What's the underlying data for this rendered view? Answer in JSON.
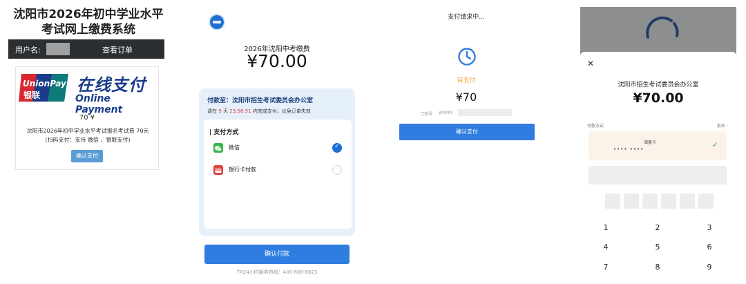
{
  "panel1": {
    "title": "沈阳市2026年初中学业水平考试网上缴费系统",
    "user_label": "用户名:",
    "orders_link": "查看订单",
    "logo_line1": "UnionPay",
    "logo_line2": "银联",
    "online_cn": "在线支付",
    "online_en": "Online Payment",
    "amount": "70 ¥",
    "desc_line1": "沈阳市2026年初中学业水平考试报名考试费 70元",
    "desc_line2": "(扫码支付：支持 微信 、银联支付)",
    "confirm_label": "确认支付",
    "colors": {
      "brand_blue": "#1b3c8c",
      "unionpay_red": "#d7282f",
      "unionpay_teal": "#0f7a7a",
      "button_blue": "#5b9bd5"
    }
  },
  "panel2": {
    "exam_title": "2026年沈阳中考缴费",
    "price": "¥70.00",
    "payee": "付款至：沈阳市招生考试委员会办公室",
    "deadline_prefix": "请在",
    "deadline_days": "9",
    "deadline_day_unit": "天",
    "deadline_time": "23:58:51",
    "deadline_suffix": "内完成支付，以免订单失效",
    "methods_title": "| 支付方式",
    "methods": [
      {
        "label": "微信",
        "icon": "wechat-icon",
        "selected": true,
        "color": "#3bb54a"
      },
      {
        "label": "银行卡付款",
        "icon": "bank-card-icon",
        "selected": false,
        "color": "#e0443d"
      }
    ],
    "pay_button": "确认付款",
    "hotline": "7X24小时服务热线：400-808-8823"
  },
  "panel3": {
    "status_title": "支付请求中...",
    "status": "待支付",
    "price": "¥70",
    "order_label": "订单号",
    "order_value": "WXPAY",
    "confirm_label": "确认支付",
    "colors": {
      "clock": "#2f7de1",
      "pending": "#f0a53a"
    }
  },
  "panel4": {
    "close_icon": "close-icon",
    "payee": "沈阳市招生考试委员会办公室",
    "price": "¥70.00",
    "pay_method_label": "付款方式",
    "change_label": "更改 ›",
    "card_type": "储蓄卡",
    "card_number": "•••• •••• ",
    "keypad": [
      "1",
      "2",
      "3",
      "4",
      "5",
      "6",
      "7",
      "8",
      "9"
    ]
  }
}
